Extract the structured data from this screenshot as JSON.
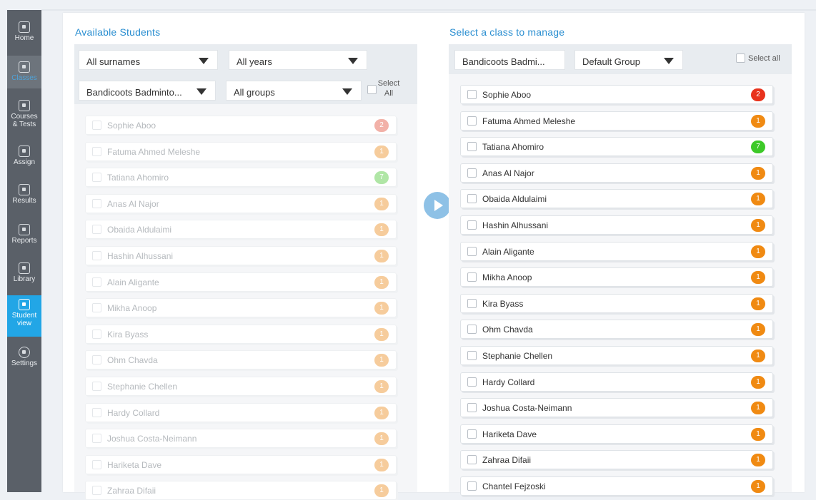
{
  "sidebar": {
    "items": [
      {
        "label": "Home",
        "icon": "home-icon"
      },
      {
        "label": "Classes",
        "icon": "classes-icon"
      },
      {
        "label": "Courses & Tests",
        "label_line1": "Courses",
        "label_line2": "& Tests",
        "icon": "courses-icon"
      },
      {
        "label": "Assign",
        "icon": "assign-icon"
      },
      {
        "label": "Results",
        "icon": "results-icon"
      },
      {
        "label": "Reports",
        "icon": "reports-icon"
      },
      {
        "label": "Library",
        "icon": "library-icon"
      },
      {
        "label": "Student view",
        "label_line1": "Student",
        "label_line2": "view",
        "icon": "student-view-icon"
      },
      {
        "label": "Settings",
        "icon": "settings-icon"
      }
    ],
    "colors": {
      "background": "#5a6068",
      "active": "#22a6e6"
    }
  },
  "left": {
    "title": "Available Students",
    "filters": {
      "surname": "All surnames",
      "year": "All years",
      "class": "Bandicoots Badminto...",
      "group": "All groups",
      "select_all_line1": "Select",
      "select_all_line2": "All"
    },
    "students": [
      {
        "name": "Sophie Aboo",
        "count": "2",
        "color": "red"
      },
      {
        "name": "Fatuma Ahmed Meleshe",
        "count": "1",
        "color": "orange"
      },
      {
        "name": "Tatiana Ahomiro",
        "count": "7",
        "color": "green"
      },
      {
        "name": "Anas Al Najor",
        "count": "1",
        "color": "orange"
      },
      {
        "name": "Obaida Aldulaimi",
        "count": "1",
        "color": "orange"
      },
      {
        "name": "Hashin Alhussani",
        "count": "1",
        "color": "orange"
      },
      {
        "name": "Alain Aligante",
        "count": "1",
        "color": "orange"
      },
      {
        "name": "Mikha Anoop",
        "count": "1",
        "color": "orange"
      },
      {
        "name": "Kira Byass",
        "count": "1",
        "color": "orange"
      },
      {
        "name": "Ohm Chavda",
        "count": "1",
        "color": "orange"
      },
      {
        "name": "Stephanie Chellen",
        "count": "1",
        "color": "orange"
      },
      {
        "name": "Hardy Collard",
        "count": "1",
        "color": "orange"
      },
      {
        "name": "Joshua Costa-Neimann",
        "count": "1",
        "color": "orange"
      },
      {
        "name": "Hariketa Dave",
        "count": "1",
        "color": "orange"
      },
      {
        "name": "Zahraa Difaii",
        "count": "1",
        "color": "orange"
      }
    ]
  },
  "right": {
    "title": "Select a class to manage",
    "filters": {
      "class": "Bandicoots Badmi...",
      "group": "Default Group",
      "select_all": "Select all"
    },
    "students": [
      {
        "name": "Sophie Aboo",
        "count": "2",
        "color": "red"
      },
      {
        "name": "Fatuma Ahmed Meleshe",
        "count": "1",
        "color": "orange"
      },
      {
        "name": "Tatiana Ahomiro",
        "count": "7",
        "color": "green"
      },
      {
        "name": "Anas Al Najor",
        "count": "1",
        "color": "orange"
      },
      {
        "name": "Obaida Aldulaimi",
        "count": "1",
        "color": "orange"
      },
      {
        "name": "Hashin Alhussani",
        "count": "1",
        "color": "orange"
      },
      {
        "name": "Alain Aligante",
        "count": "1",
        "color": "orange"
      },
      {
        "name": "Mikha Anoop",
        "count": "1",
        "color": "orange"
      },
      {
        "name": "Kira Byass",
        "count": "1",
        "color": "orange"
      },
      {
        "name": "Ohm Chavda",
        "count": "1",
        "color": "orange"
      },
      {
        "name": "Stephanie Chellen",
        "count": "1",
        "color": "orange"
      },
      {
        "name": "Hardy Collard",
        "count": "1",
        "color": "orange"
      },
      {
        "name": "Joshua Costa-Neimann",
        "count": "1",
        "color": "orange"
      },
      {
        "name": "Hariketa Dave",
        "count": "1",
        "color": "orange"
      },
      {
        "name": "Zahraa Difaii",
        "count": "1",
        "color": "orange"
      },
      {
        "name": "Chantel Fejzoski",
        "count": "1",
        "color": "orange"
      }
    ]
  },
  "transfer_button": {
    "icon": "play-icon"
  }
}
